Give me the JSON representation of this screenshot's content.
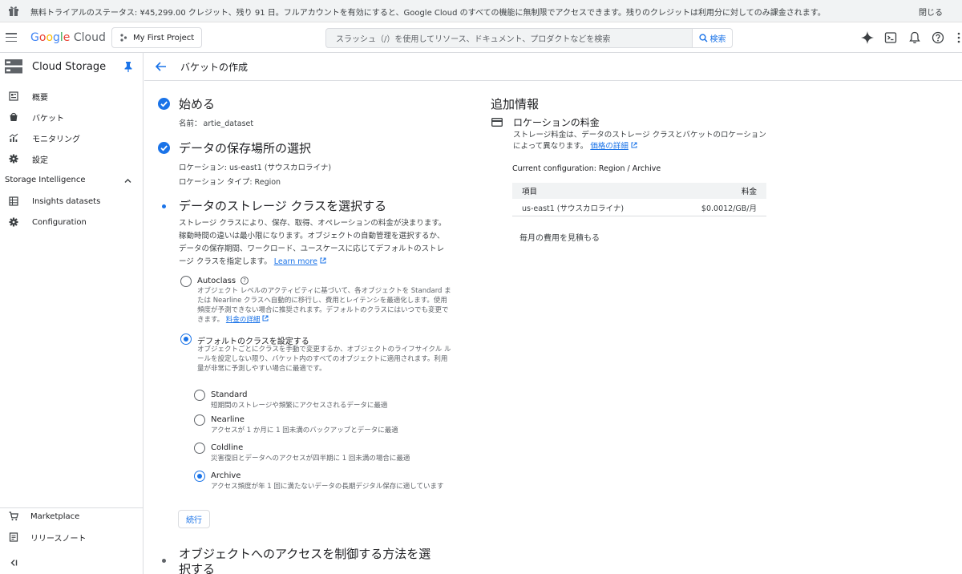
{
  "banner": {
    "message": "無料トライアルのステータス: ¥45,299.00 クレジット、残り 91 日。フルアカウントを有効にすると、Google Cloud のすべての機能に無制限でアクセスできます。残りのクレジットは利用分に対してのみ課金されます。",
    "close_label": "閉じる"
  },
  "header": {
    "logo_google_g": "G",
    "logo_google_o1": "o",
    "logo_google_o2": "o",
    "logo_google_g2": "g",
    "logo_google_l": "l",
    "logo_google_e": "e",
    "logo_cloud": " Cloud",
    "project_label": "My First Project",
    "search_placeholder": "スラッシュ（/）を使用してリソース、ドキュメント、プロダクトなどを検索",
    "search_button": "検索"
  },
  "sidebar": {
    "product_title": "Cloud Storage",
    "items": [
      {
        "label": "概要",
        "icon": "overview-icon"
      },
      {
        "label": "バケット",
        "icon": "bucket-icon"
      },
      {
        "label": "モニタリング",
        "icon": "monitoring-icon"
      },
      {
        "label": "設定",
        "icon": "settings-icon"
      }
    ],
    "section_title": "Storage Intelligence",
    "section_items": [
      {
        "label": "Insights datasets",
        "icon": "dataset-icon"
      },
      {
        "label": "Configuration",
        "icon": "gear-icon"
      }
    ],
    "footer_items": [
      {
        "label": "Marketplace",
        "icon": "cart-icon"
      },
      {
        "label": "リリースノート",
        "icon": "notes-icon"
      }
    ]
  },
  "page": {
    "title": "バケットの作成"
  },
  "steps": {
    "start": {
      "title": "始める",
      "name_label": "名前：",
      "name_value": "artie_dataset"
    },
    "location": {
      "title": "データの保存場所の選択",
      "location_line": "ロケーション: us-east1 (サウスカロライナ)",
      "type_line": "ロケーション タイプ: Region"
    },
    "storage_class": {
      "title": "データのストレージ クラスを選択する",
      "description": "ストレージ クラスにより、保存、取得、オペレーションの料金が決まります。稼動時間の違いは最小限になります。オブジェクトの自動管理を選択するか、データの保存期間、ワークロード、ユースケースに応じてデフォルトのストレージ クラスを指定します。",
      "learn_more": "Learn more",
      "autoclass_label": "Autoclass",
      "autoclass_desc": "オブジェクト レベルのアクティビティに基づいて、各オブジェクトを Standard または Nearline クラスへ自動的に移行し、費用とレイテンシを最適化します。使用頻度が予測できない場合に推奨されます。デフォルトのクラスにはいつでも変更できます。",
      "autoclass_link": "料金の詳細",
      "default_label": "デフォルトのクラスを設定する",
      "default_desc": "オブジェクトごとにクラスを手動で変更するか、オブジェクトのライフサイクル ルールを設定しない限り、バケット内のすべてのオブジェクトに適用されます。利用量が非常に予測しやすい場合に最適です。",
      "classes": [
        {
          "label": "Standard",
          "desc": "短期間のストレージや頻繁にアクセスされるデータに最適",
          "selected": false
        },
        {
          "label": "Nearline",
          "desc": "アクセスが 1 か月に 1 回未満のバックアップとデータに最適",
          "selected": false
        },
        {
          "label": "Coldline",
          "desc": "災害復旧とデータへのアクセスが四半期に 1 回未満の場合に最適",
          "selected": false
        },
        {
          "label": "Archive",
          "desc": "アクセス頻度が年 1 回に満たないデータの長期デジタル保存に適しています",
          "selected": true
        }
      ],
      "continue_label": "続行"
    },
    "access": {
      "title_line1": "オブジェクトへのアクセスを制御する方法を選",
      "title_line2": "択する"
    }
  },
  "info_panel": {
    "heading": "追加情報",
    "subheading": "ロケーションの料金",
    "description": "ストレージ料金は、データのストレージ クラスとバケットのロケーションによって異なります。",
    "pricing_link": "価格の詳細",
    "current_config": "Current configuration: Region / Archive",
    "table": {
      "col_item": "項目",
      "col_price": "料金",
      "rows": [
        {
          "item": "us-east1 (サウスカロライナ)",
          "price": "$0.0012/GB/月"
        }
      ]
    },
    "estimate_link": "毎月の費用を見積もる"
  }
}
